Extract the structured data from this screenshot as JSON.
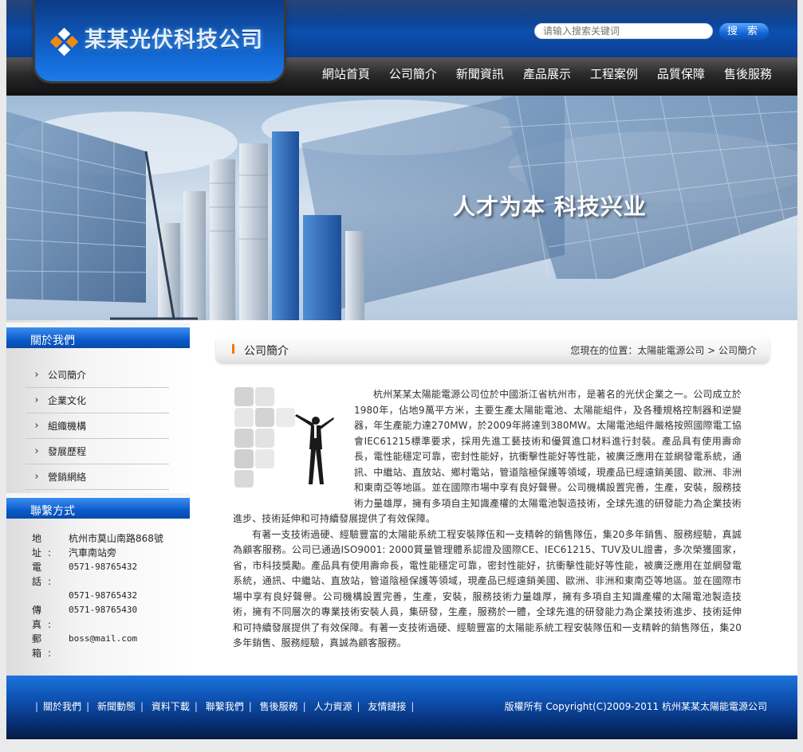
{
  "header": {
    "company_name": "某某光伏科技公司",
    "search_placeholder": "请输入搜索关键词",
    "search_button": "搜 索"
  },
  "nav": [
    "網站首頁",
    "公司簡介",
    "新聞資訊",
    "產品展示",
    "工程案例",
    "品質保障",
    "售後服務"
  ],
  "banner": {
    "slogan": "人才为本 科技兴业"
  },
  "sidebar": {
    "about_title": "關於我們",
    "about_items": [
      "公司簡介",
      "企業文化",
      "組織機構",
      "發展歷程",
      "營銷網絡"
    ],
    "contact_title": "聯繫方式",
    "contact": {
      "address_label": "地 址:",
      "address": "杭州市莫山南路868號汽車南站旁",
      "phone_label": "電 話:",
      "phone1": "0571-98765432",
      "phone2": "0571-98765432",
      "fax_label": "傳 真:",
      "fax": "0571-98765430",
      "email_label": "郵 箱:",
      "email": "boss@mail.com"
    }
  },
  "content": {
    "title": "公司簡介",
    "breadcrumb": "您現在的位置：太陽能電源公司 > 公司簡介",
    "paragraph1": "杭州某某太陽能電源公司位於中國浙江省杭州市，是著名的光伏企業之一。公司成立於1980年，佔地9萬平方米，主要生產太陽能電池、太陽能組件，及各種規格控制器和逆變器，年生產能力達270MW，於2009年將達到380MW。太陽電池組件嚴格按照國際電工協會IEC61215標準要求，採用先進工藝技術和優質進口材料進行封裝。產品具有使用壽命長，電性能穩定可靠，密封性能好，抗衝擊性能好等性能，被廣泛應用在並網發電系統，通訊、中繼站、直放站、鄉村電站，管道陰極保護等領域，現產品已經遠銷美國、歐洲、非洲和東南亞等地區。並在國際市場中享有良好聲譽。公司機構設置完善，生產，安裝，服務技術力量雄厚，擁有多項自主知識產權的太陽電池製造技術，全球先進的研發能力為企業技術進步、技術延伸和可持續發展提供了有效保障。",
    "paragraph2": "有著一支技術過硬、經驗豐富的太陽能系統工程安裝隊伍和一支精幹的銷售隊伍，集20多年銷售、服務經驗，真誠為顧客服務。公司已通過ISO9001: 2000質量管理體系認證及國際CE、IEC61215、TUV及UL證書，多次榮獲國家，省，市科技獎勵。產品具有使用壽命長，電性能穩定可靠，密封性能好，抗衝擊性能好等性能，被廣泛應用在並網發電系統，通訊、中繼站、直放站，管道陰極保護等領域，現產品已經遠銷美國、歐洲、非洲和東南亞等地區。並在國際市場中享有良好聲譽。公司機構設置完善，生產，安裝，服務技術力量雄厚，擁有多項自主知識產權的太陽電池製造技術，擁有不同層次的專業技術安裝人員，集研發，生產，服務於一體，全球先進的研發能力為企業技術進步、技術延伸和可持續發展提供了有效保障。有著一支技術過硬、經驗豐富的太陽能系統工程安裝隊伍和一支精幹的銷售隊伍，集20多年銷售、服務經驗，真誠為顧客服務。"
  },
  "footer": {
    "links": [
      "關於我們",
      "新聞動態",
      "資料下載",
      "聯繫我們",
      "售後服務",
      "人力資源",
      "友情鏈接"
    ],
    "copyright": "版權所有 Copyright(C)2009-2011 杭州某某太陽能電源公司"
  },
  "colors": {
    "brand_blue": "#0c4fae",
    "accent_orange": "#f07a00",
    "nav_dark": "#2a2a2a"
  }
}
